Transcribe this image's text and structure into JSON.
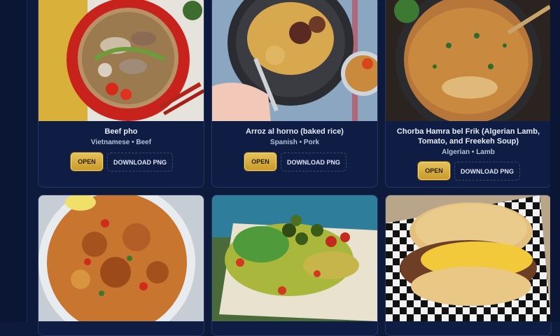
{
  "cards": [
    {
      "title": "Beef pho",
      "cuisine": "Vietnamese",
      "protein": "Beef",
      "meta": "Vietnamese • Beef",
      "open_label": "OPEN",
      "download_label": "DOWNLOAD PNG"
    },
    {
      "title": "Arroz al horno (baked rice)",
      "cuisine": "Spanish",
      "protein": "Pork",
      "meta": "Spanish • Pork",
      "open_label": "OPEN",
      "download_label": "DOWNLOAD PNG"
    },
    {
      "title_line1": "Chorba Hamra bel Frik (Algerian Lamb,",
      "title_line2": "Tomato, and Freekeh Soup)",
      "cuisine": "Algerian",
      "protein": "Lamb",
      "meta": "Algerian • Lamb",
      "open_label": "OPEN",
      "download_label": "DOWNLOAD PNG"
    }
  ],
  "bottom_row": [
    {
      "image": "chicken-rice-dish"
    },
    {
      "image": "nachos-salad-plate"
    },
    {
      "image": "arepa-shredded-beef"
    }
  ],
  "colors": {
    "background": "#0e1a3c",
    "card": "#0f1d44",
    "accent_gold": "#d6ad3f"
  }
}
